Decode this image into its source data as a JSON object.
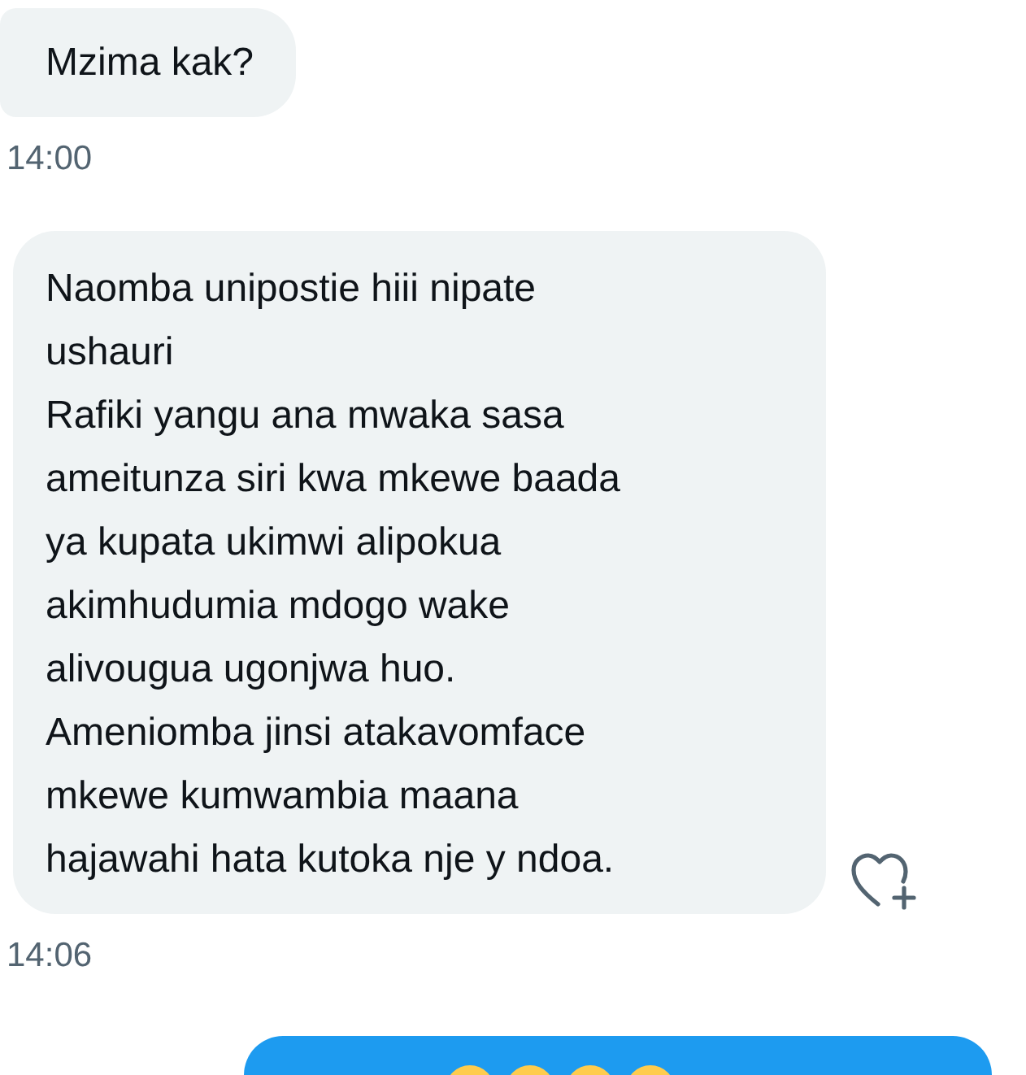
{
  "messages": [
    {
      "kind": "received",
      "text": "Mzima kak?",
      "time": "14:00",
      "reaction": false
    },
    {
      "kind": "received",
      "text": "Naomba unipostie hiii nipate\nushauri\nRafiki yangu ana mwaka sasa\nameitunza siri kwa mkewe baada\nya kupata ukimwi alipokua\nakimhudumia mdogo wake\nalivougua ugonjwa huo.\nAmeniomba jinsi atakavomface\nmkewe kumwambia maana\nhajawahi hata kutoka nje y ndoa.",
      "time": "14:06",
      "reaction": true
    },
    {
      "kind": "sent"
    }
  ]
}
